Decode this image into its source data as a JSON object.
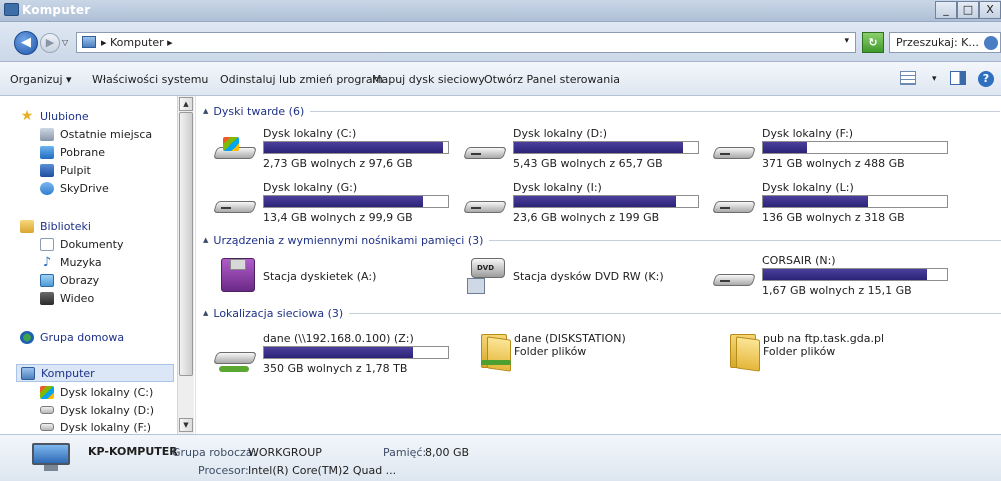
{
  "window": {
    "title": "Komputer",
    "controls": [
      "_",
      "□",
      "X"
    ]
  },
  "address": {
    "back_glyph": "◀",
    "forward_glyph": "▶",
    "history_glyph": "▽",
    "breadcrumb": "▸ Komputer ▸",
    "dropdown_glyph": "▾",
    "refresh_glyph": "↻",
    "search_placeholder": "Przeszukaj: K..."
  },
  "toolbar": {
    "organize": "Organizuj ▾",
    "system_properties": "Właściwości systemu",
    "uninstall": "Odinstaluj lub zmień program",
    "map_drive": "Mapuj dysk sieciowy",
    "control_panel": "Otwórz Panel sterowania",
    "views_dropdown": "▾",
    "help": "?"
  },
  "sidebar": {
    "favorites": {
      "header": "Ulubione",
      "items": [
        "Ostatnie miejsca",
        "Pobrane",
        "Pulpit",
        "SkyDrive"
      ]
    },
    "libraries": {
      "header": "Biblioteki",
      "items": [
        "Dokumenty",
        "Muzyka",
        "Obrazy",
        "Wideo"
      ]
    },
    "homegroup": "Grupa domowa",
    "computer": {
      "header": "Komputer",
      "items": [
        "Dysk lokalny (C:)",
        "Dysk lokalny (D:)",
        "Dysk lokalny (F:)"
      ]
    },
    "scroll_up": "▲",
    "scroll_down": "▼",
    "star_glyph": "★",
    "music_glyph": "♪"
  },
  "groups": {
    "hard_drives": {
      "header": "Dyski twarde (6)",
      "drives": [
        {
          "name": "Dysk lokalny (C:)",
          "free": "2,73 GB wolnych z 97,6 GB",
          "used_fraction": 0.972,
          "system": true
        },
        {
          "name": "Dysk lokalny (D:)",
          "free": "5,43 GB wolnych z 65,7 GB",
          "used_fraction": 0.917,
          "system": false
        },
        {
          "name": "Dysk lokalny (F:)",
          "free": "371 GB wolnych z 488 GB",
          "used_fraction": 0.24,
          "system": false
        },
        {
          "name": "Dysk lokalny (G:)",
          "free": "13,4 GB wolnych z 99,9 GB",
          "used_fraction": 0.866,
          "system": false
        },
        {
          "name": "Dysk lokalny (I:)",
          "free": "23,6 GB wolnych z 199 GB",
          "used_fraction": 0.881,
          "system": false
        },
        {
          "name": "Dysk lokalny (L:)",
          "free": "136 GB wolnych z 318 GB",
          "used_fraction": 0.572,
          "system": false
        }
      ]
    },
    "removable": {
      "header": "Urządzenia z wymiennymi nośnikami pamięci (3)",
      "floppy": "Stacja dyskietek (A:)",
      "dvd": "Stacja dysków DVD RW (K:)",
      "dvd_label": "DVD",
      "corsair": {
        "name": "CORSAIR (N:)",
        "free": "1,67 GB wolnych z 15,1 GB",
        "used_fraction": 0.89
      }
    },
    "network": {
      "header": "Lokalizacja sieciowa (3)",
      "mapped": {
        "name": "dane (\\\\192.168.0.100) (Z:)",
        "free": "350 GB wolnych z 1,78 TB",
        "used_fraction": 0.808
      },
      "folders": [
        {
          "name": "dane (DISKSTATION)",
          "type": "Folder plików"
        },
        {
          "name": "pub na ftp.task.gda.pl",
          "type": "Folder plików"
        }
      ]
    }
  },
  "details": {
    "computer_name": "KP-KOMPUTER",
    "workgroup_label": "Grupa robocza:",
    "workgroup": "WORKGROUP",
    "memory_label": "Pamięć:",
    "memory": "8,00 GB",
    "processor_label": "Procesor:",
    "processor": "Intel(R) Core(TM)2 Quad ..."
  }
}
